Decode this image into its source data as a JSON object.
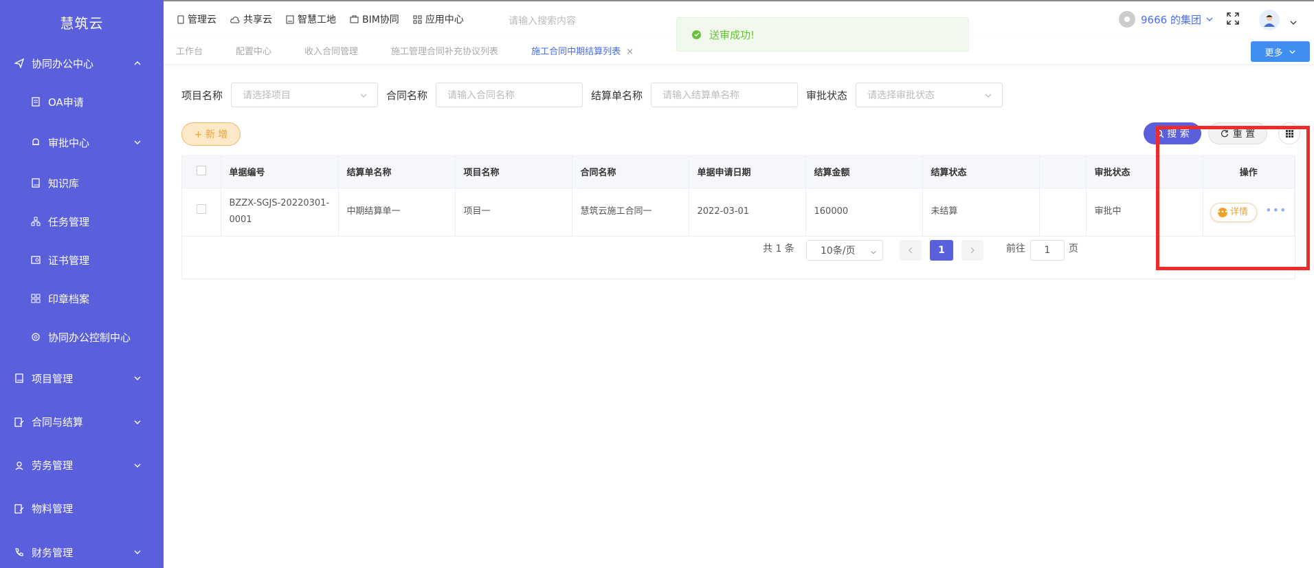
{
  "sidebar": {
    "logo": "慧筑云",
    "items": [
      {
        "label": "协同办公中心",
        "icon": "send-icon",
        "expanded": true
      },
      {
        "label": "OA申请",
        "icon": "document-icon"
      },
      {
        "label": "审批中心",
        "icon": "bell-icon"
      },
      {
        "label": "知识库",
        "icon": "book-icon"
      },
      {
        "label": "任务管理",
        "icon": "hierarchy-icon"
      },
      {
        "label": "证书管理",
        "icon": "certificate-icon"
      },
      {
        "label": "印章档案",
        "icon": "grid-icon"
      },
      {
        "label": "协同办公控制中心",
        "icon": "gear-icon"
      },
      {
        "label": "项目管理",
        "icon": "book-icon"
      },
      {
        "label": "合同与结算",
        "icon": "edit-doc-icon"
      },
      {
        "label": "劳务管理",
        "icon": "worker-icon"
      },
      {
        "label": "物料管理",
        "icon": "edit-doc-icon"
      },
      {
        "label": "财务管理",
        "icon": "phone-icon"
      }
    ]
  },
  "topnav": {
    "items": [
      "管理云",
      "共享云",
      "智慧工地",
      "BIM协同",
      "应用中心"
    ],
    "search_hint": "请输入搜索内容",
    "group": "9666 的集团"
  },
  "tabs": {
    "items": [
      "工作台",
      "配置中心",
      "收入合同管理",
      "施工管理合同补充协议列表",
      "施工合同中期结算列表"
    ],
    "more_label": "更多"
  },
  "toast": {
    "message": "送审成功!"
  },
  "filters": {
    "project_label": "项目名称",
    "project_placeholder": "请选择项目",
    "contract_label": "合同名称",
    "contract_placeholder": "请输入合同名称",
    "settle_label": "结算单名称",
    "settle_placeholder": "请输入结算单名称",
    "status_label": "审批状态",
    "status_placeholder": "请选择审批状态"
  },
  "actions": {
    "add_label": "+ 新 增",
    "search_label": "搜 索",
    "reset_label": "重 置"
  },
  "table": {
    "headers": [
      "单据编号",
      "结算单名称",
      "项目名称",
      "合同名称",
      "单据申请日期",
      "结算金额",
      "结算状态",
      "",
      "审批状态",
      "操作"
    ],
    "rows": [
      {
        "doc_no": "BZZX-SGJS-20220301-0001",
        "settle_name": "中期结算单一",
        "project": "项目一",
        "contract": "慧筑云施工合同一",
        "date": "2022-03-01",
        "amount": "160000",
        "settle_status": "未结算",
        "blank": "",
        "approval_status": "审批中",
        "detail_label": "详情",
        "more_label": "•••"
      }
    ]
  },
  "pager": {
    "total": "共 1 条",
    "size": "10条/页",
    "current": "1",
    "goto_label": "前往",
    "goto_value": "1",
    "page_word": "页"
  },
  "colors": {
    "sidebar": "#5a5fdc",
    "primary": "#5a5fdc",
    "success": "#67c23a",
    "warning": "#e6a23c",
    "highlight": "#ee2b2b"
  }
}
